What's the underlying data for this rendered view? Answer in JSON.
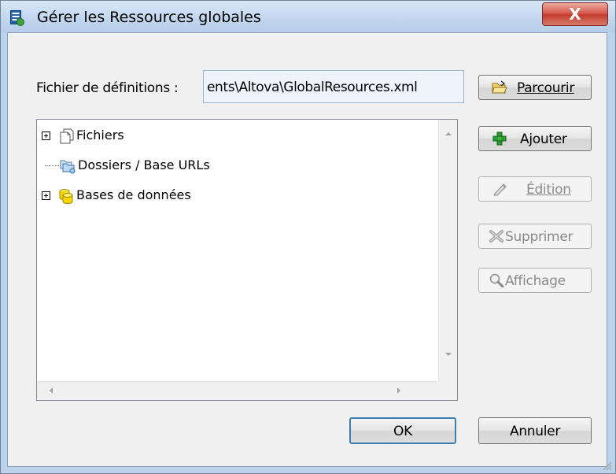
{
  "window": {
    "title": "Gérer les Ressources globales",
    "close_label": "X"
  },
  "definitions": {
    "label": "Fichier de définitions :",
    "path_value": "ents\\Altova\\GlobalResources.xml"
  },
  "buttons": {
    "browse": {
      "label": "Parcourir",
      "mnemonic": "P",
      "icon": "open-folder-icon",
      "enabled": true
    },
    "add": {
      "label": "Ajouter",
      "mnemonic": "A",
      "icon": "green-plus-icon",
      "enabled": true
    },
    "edit": {
      "label": "Édition",
      "mnemonic": "É",
      "icon": "pencil-icon",
      "enabled": false
    },
    "delete": {
      "label": "Supprimer",
      "mnemonic": "S",
      "icon": "delete-cross-icon",
      "enabled": false
    },
    "view": {
      "label": "Affichage",
      "mnemonic": "A",
      "icon": "magnifier-icon",
      "enabled": false
    },
    "ok": {
      "label": "OK"
    },
    "cancel": {
      "label": "Annuler"
    }
  },
  "tree": {
    "items": [
      {
        "label": "Fichiers",
        "icon": "files-icon",
        "expandable": true
      },
      {
        "label": "Dossiers / Base URLs",
        "icon": "folders-icon",
        "expandable": false
      },
      {
        "label": "Bases de données",
        "icon": "database-icon",
        "expandable": true
      }
    ]
  },
  "colors": {
    "title_bar": "#c1d6ee",
    "close_button": "#c53b2e",
    "dialog_face": "#f0f0f0",
    "default_button_border": "#3c7fb1"
  }
}
